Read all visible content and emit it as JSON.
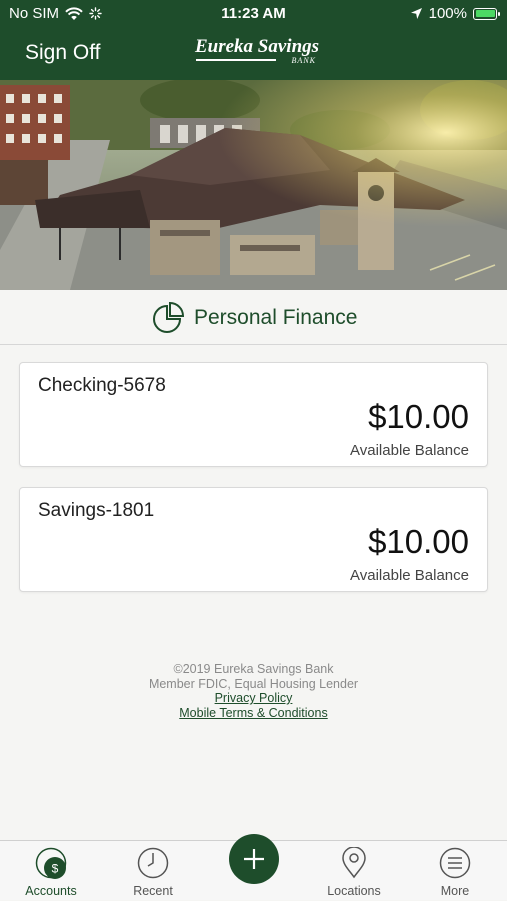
{
  "status_bar": {
    "carrier": "No SIM",
    "time": "11:23 AM",
    "battery": "100%"
  },
  "header": {
    "sign_off": "Sign Off",
    "logo_name": "Eureka Savings",
    "logo_sub": "BANK"
  },
  "section": {
    "title": "Personal Finance"
  },
  "accounts": [
    {
      "name": "Checking-5678",
      "balance": "$10.00",
      "balance_label": "Available Balance"
    },
    {
      "name": "Savings-1801",
      "balance": "$10.00",
      "balance_label": "Available Balance"
    }
  ],
  "footer": {
    "copyright": "©2019 Eureka Savings Bank",
    "fdic": "Member FDIC, Equal Housing Lender",
    "privacy": "Privacy Policy",
    "terms": "Mobile Terms & Conditions"
  },
  "tabs": [
    {
      "label": "Accounts",
      "icon": "accounts-icon",
      "active": true
    },
    {
      "label": "Recent",
      "icon": "clock-icon",
      "active": false
    },
    {
      "label": "",
      "icon": "plus-icon",
      "active": false
    },
    {
      "label": "Locations",
      "icon": "location-pin-icon",
      "active": false
    },
    {
      "label": "More",
      "icon": "menu-icon",
      "active": false
    }
  ],
  "colors": {
    "brand_green": "#1e4d2b",
    "background": "#f5f5f3",
    "battery_green": "#4cd964"
  }
}
